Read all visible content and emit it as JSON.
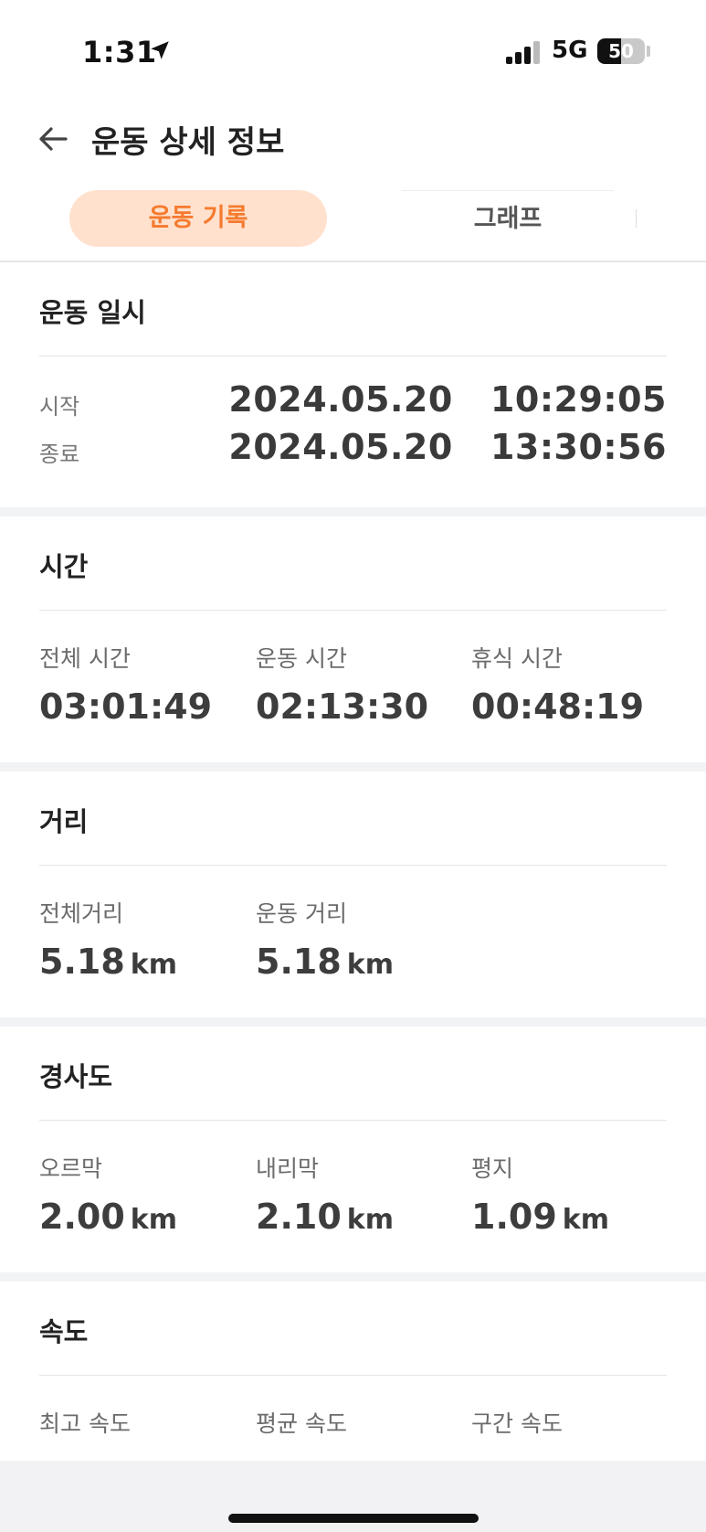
{
  "status_bar": {
    "time": "1:31",
    "network": "5G",
    "battery": "50",
    "battery_level": 0.5
  },
  "header": {
    "title": "운동 상세 정보",
    "back_icon": "arrow-left-icon"
  },
  "tabs": [
    {
      "label": "운동 기록",
      "active": true
    },
    {
      "label": "그래프",
      "active": false
    }
  ],
  "sections": {
    "datetime": {
      "title": "운동 일시",
      "start_label": "시작",
      "start_value": "2024.05.20   10:29:05",
      "end_label": "종료",
      "end_value": "2024.05.20   13:30:56"
    },
    "time": {
      "title": "시간",
      "stats": [
        {
          "label": "전체 시간",
          "value": "03:01:49"
        },
        {
          "label": "운동 시간",
          "value": "02:13:30"
        },
        {
          "label": "휴식 시간",
          "value": "00:48:19"
        }
      ]
    },
    "distance": {
      "title": "거리",
      "stats": [
        {
          "label": "전체거리",
          "value": "5.18",
          "unit": "km"
        },
        {
          "label": "운동 거리",
          "value": "5.18",
          "unit": "km"
        }
      ]
    },
    "slope": {
      "title": "경사도",
      "stats": [
        {
          "label": "오르막",
          "value": "2.00",
          "unit": "km"
        },
        {
          "label": "내리막",
          "value": "2.10",
          "unit": "km"
        },
        {
          "label": "평지",
          "value": "1.09",
          "unit": "km"
        }
      ]
    },
    "speed": {
      "title": "속도",
      "stats": [
        {
          "label": "최고 속도"
        },
        {
          "label": "평균 속도"
        },
        {
          "label": "구간 속도"
        }
      ]
    }
  },
  "colors": {
    "accent": "#f57a2e",
    "accent_bg": "#ffe1cd",
    "section_gap": "#f2f3f5"
  }
}
